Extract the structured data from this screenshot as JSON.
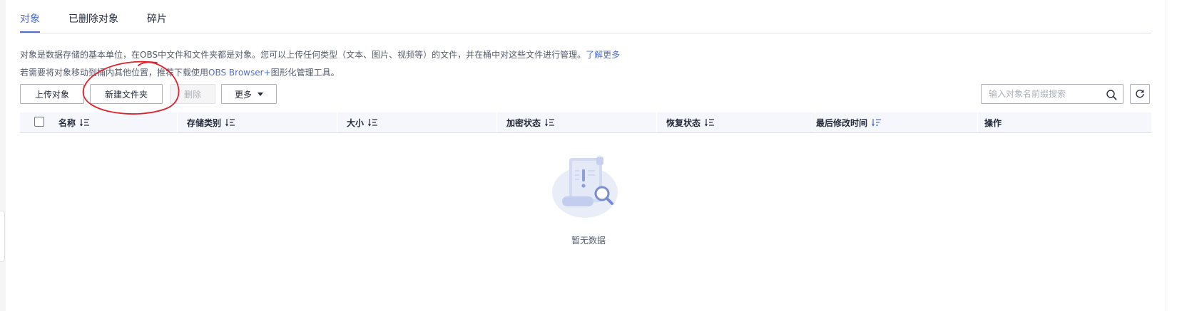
{
  "tabs": [
    {
      "label": "对象",
      "active": true
    },
    {
      "label": "已删除对象",
      "active": false
    },
    {
      "label": "碎片",
      "active": false
    }
  ],
  "description": {
    "line1": "对象是数据存储的基本单位，在OBS中文件和文件夹都是对象。您可以上传任何类型（文本、图片、视频等）的文件，并在桶中对这些文件进行管理。",
    "line1_link": "了解更多",
    "line2_prefix": "若需要将对象移动到桶内其他位置，推荐下载使用",
    "line2_highlight": "OBS Browser+",
    "line2_suffix": "图形化管理工具。"
  },
  "toolbar": {
    "upload_label": "上传对象",
    "new_folder_label": "新建文件夹",
    "delete_label": "删除",
    "more_label": "更多"
  },
  "search": {
    "placeholder": "输入对象名前缀搜索"
  },
  "table": {
    "columns": [
      "名称",
      "存储类别",
      "大小",
      "加密状态",
      "恢复状态",
      "最后修改时间",
      "操作"
    ]
  },
  "empty_state": {
    "text": "暂无数据"
  },
  "colors": {
    "accent": "#526ecc",
    "annotation": "#e0202b"
  },
  "icons": [
    "search-icon",
    "refresh-icon",
    "sort-icon",
    "empty-document-icon",
    "caret-down-icon"
  ]
}
